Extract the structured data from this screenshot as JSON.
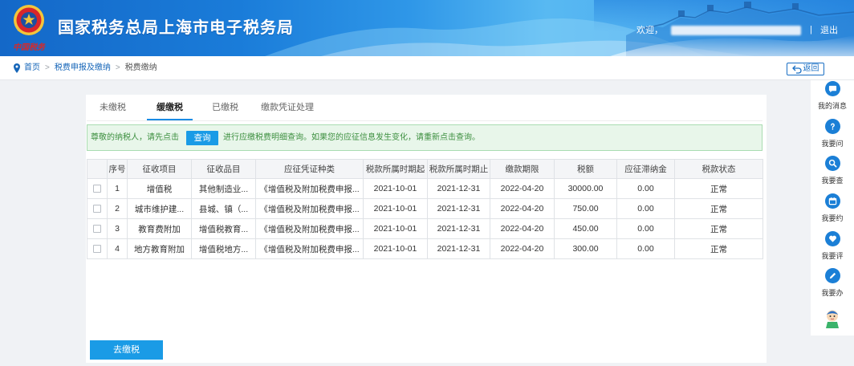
{
  "header": {
    "logo_text": "中国税务",
    "title": "国家税务总局上海市电子税务局",
    "welcome": "欢迎，",
    "separator": "|",
    "logout": "退出"
  },
  "breadcrumb": {
    "home": "首页",
    "section": "税费申报及缴纳",
    "current": "税费缴纳",
    "separator": ">"
  },
  "back_button": "返回",
  "tabs": [
    {
      "label": "未缴税",
      "active": false
    },
    {
      "label": "缓缴税",
      "active": true
    },
    {
      "label": "已缴税",
      "active": false
    },
    {
      "label": "缴款凭证处理",
      "active": false
    }
  ],
  "notice": {
    "text_before": "尊敬的纳税人，请先点击",
    "query_button": "查询",
    "text_after": "进行应缴税费明细查询。如果您的应征信息发生变化，请重新点击查询。"
  },
  "table": {
    "headers": [
      "序号",
      "征收项目",
      "征收品目",
      "应征凭证种类",
      "税款所属时期起",
      "税款所属时期止",
      "缴款期限",
      "税额",
      "应征滞纳金",
      "税款状态"
    ],
    "rows": [
      {
        "checked": false,
        "cells": [
          "1",
          "增值税",
          "其他制造业...",
          "《增值税及附加税费申报...",
          "2021-10-01",
          "2021-12-31",
          "2022-04-20",
          "30000.00",
          "0.00",
          "正常"
        ]
      },
      {
        "checked": false,
        "cells": [
          "2",
          "城市维护建...",
          "县城、镇（...",
          "《增值税及附加税费申报...",
          "2021-10-01",
          "2021-12-31",
          "2022-04-20",
          "750.00",
          "0.00",
          "正常"
        ]
      },
      {
        "checked": false,
        "cells": [
          "3",
          "教育费附加",
          "增值税教育...",
          "《增值税及附加税费申报...",
          "2021-10-01",
          "2021-12-31",
          "2022-04-20",
          "450.00",
          "0.00",
          "正常"
        ]
      },
      {
        "checked": false,
        "cells": [
          "4",
          "地方教育附加",
          "增值税地方...",
          "《增值税及附加税费申报...",
          "2021-10-01",
          "2021-12-31",
          "2022-04-20",
          "300.00",
          "0.00",
          "正常"
        ]
      }
    ]
  },
  "pay_button": "去缴税",
  "sidebar": [
    {
      "label": "我的消息",
      "icon": "message-icon"
    },
    {
      "label": "我要问",
      "icon": "question-icon"
    },
    {
      "label": "我要查",
      "icon": "search-icon"
    },
    {
      "label": "我要约",
      "icon": "calendar-icon"
    },
    {
      "label": "我要评",
      "icon": "heart-icon"
    },
    {
      "label": "我要办",
      "icon": "pen-icon"
    }
  ],
  "colors": {
    "accent": "#1a9be6",
    "link": "#1565b8",
    "notice_bg": "#e8f6ea",
    "notice_text": "#3c8f3f",
    "sidebar_icon": "#1b7fd6"
  }
}
